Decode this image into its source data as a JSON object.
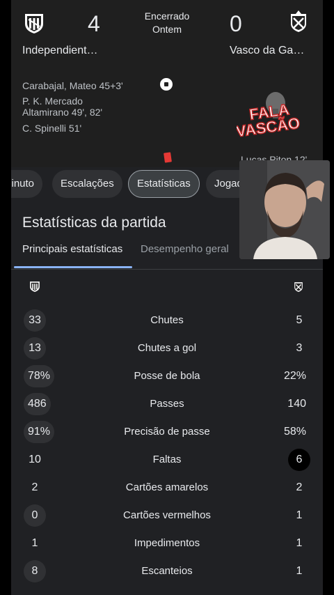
{
  "match": {
    "home_team": "Independient…",
    "away_team": "Vasco da Ga…",
    "home_score": "4",
    "away_score": "0",
    "status_line1": "Encerrado",
    "status_line2": "Ontem"
  },
  "scorers": {
    "home": [
      "Carabajal, Mateo 45+3'",
      "P. K. Mercado",
      "Altamirano 49', 82'",
      "C. Spinelli 51'"
    ],
    "away_red_card": "Lucas Piton 12'"
  },
  "tabs": [
    "minuto",
    "Escalações",
    "Estatísticas",
    "Jogado"
  ],
  "active_tab": "Estatísticas",
  "section_title": "Estatísticas da partida",
  "subtabs": [
    "Principais estatísticas",
    "Desempenho geral"
  ],
  "stats": [
    {
      "label": "Chutes",
      "home": "33",
      "away": "5",
      "home_pill": "dark",
      "away_pill": "none"
    },
    {
      "label": "Chutes a gol",
      "home": "13",
      "away": "3",
      "home_pill": "dark",
      "away_pill": "none"
    },
    {
      "label": "Posse de bola",
      "home": "78%",
      "away": "22%",
      "home_pill": "dark",
      "away_pill": "none"
    },
    {
      "label": "Passes",
      "home": "486",
      "away": "140",
      "home_pill": "dark",
      "away_pill": "none"
    },
    {
      "label": "Precisão de passe",
      "home": "91%",
      "away": "58%",
      "home_pill": "dark",
      "away_pill": "none"
    },
    {
      "label": "Faltas",
      "home": "10",
      "away": "6",
      "home_pill": "none",
      "away_pill": "black"
    },
    {
      "label": "Cartões amarelos",
      "home": "2",
      "away": "2",
      "home_pill": "none",
      "away_pill": "none"
    },
    {
      "label": "Cartões vermelhos",
      "home": "0",
      "away": "1",
      "home_pill": "dark",
      "away_pill": "none"
    },
    {
      "label": "Impedimentos",
      "home": "1",
      "away": "1",
      "home_pill": "none",
      "away_pill": "none"
    },
    {
      "label": "Escanteios",
      "home": "8",
      "away": "1",
      "home_pill": "dark",
      "away_pill": "none"
    }
  ],
  "overlay": {
    "logo_line1": "FALA",
    "logo_line2": "VASCÃO"
  },
  "colors": {
    "background": "#202124",
    "accent": "#8ab4f8",
    "chip": "#303134",
    "red_card": "#e53935"
  }
}
